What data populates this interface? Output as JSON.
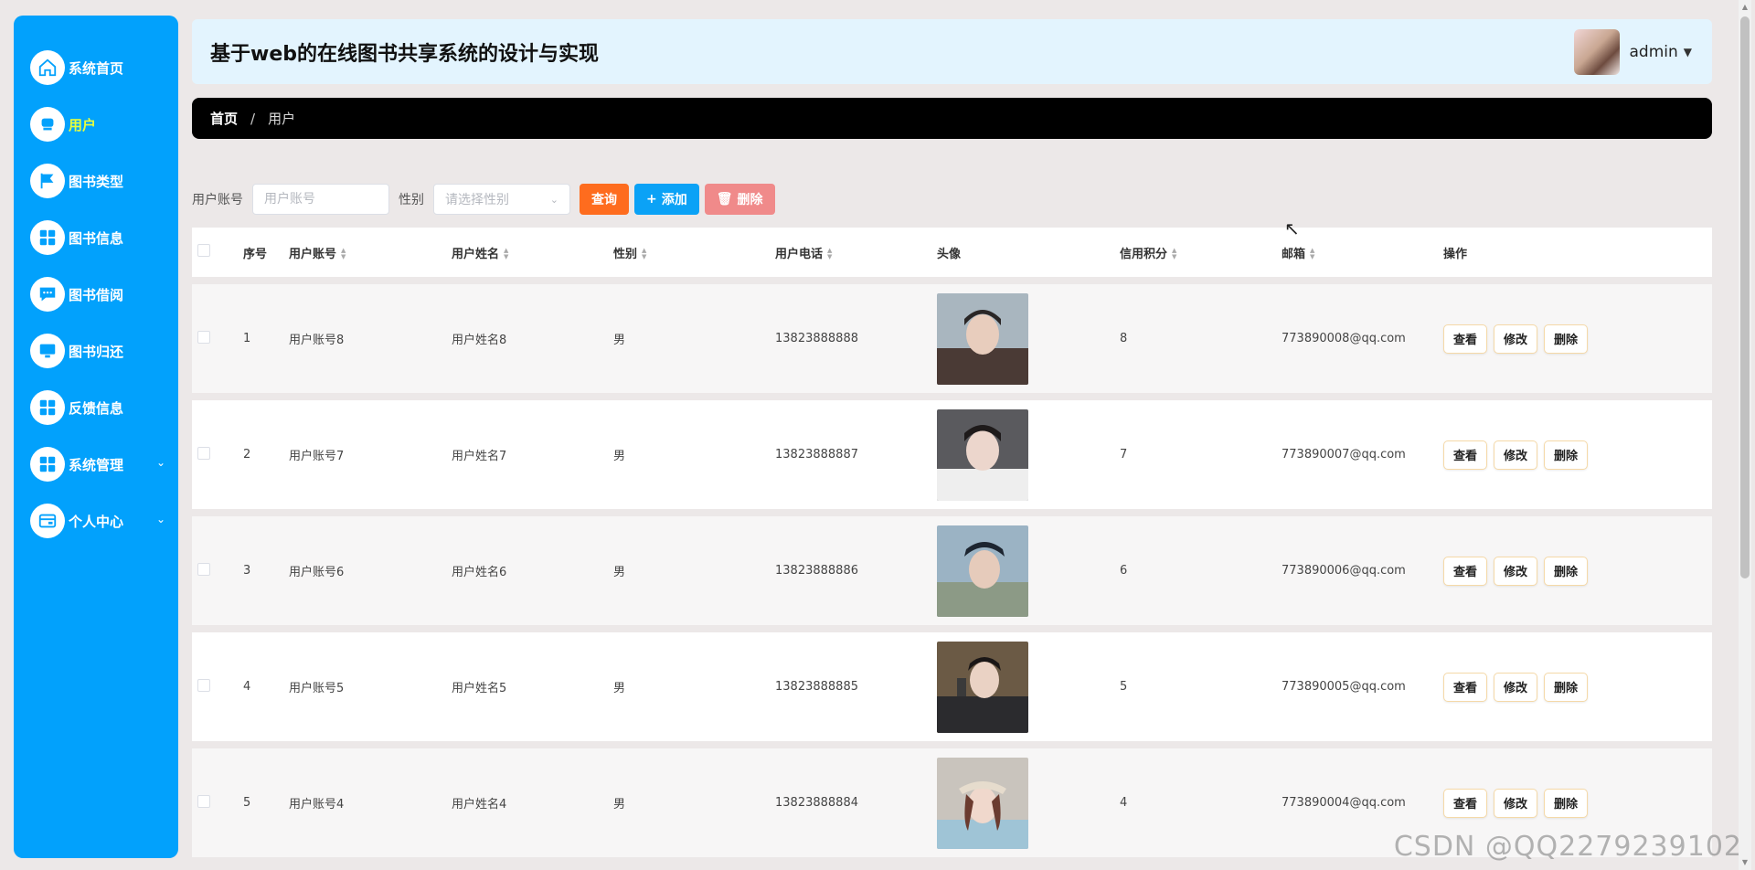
{
  "sidebar": {
    "items": [
      {
        "label": "系统首页",
        "icon": "home-icon"
      },
      {
        "label": "用户",
        "icon": "user-icon",
        "active": true
      },
      {
        "label": "图书类型",
        "icon": "flag-icon"
      },
      {
        "label": "图书信息",
        "icon": "grid-icon"
      },
      {
        "label": "图书借阅",
        "icon": "chat-icon"
      },
      {
        "label": "图书归还",
        "icon": "monitor-icon"
      },
      {
        "label": "反馈信息",
        "icon": "grid-icon"
      },
      {
        "label": "系统管理",
        "icon": "grid-icon",
        "expandable": true
      },
      {
        "label": "个人中心",
        "icon": "card-icon",
        "expandable": true
      }
    ]
  },
  "header": {
    "title": "基于web的在线图书共享系统的设计与实现",
    "user_name": "admin"
  },
  "breadcrumb": {
    "home": "首页",
    "separator": "/",
    "current": "用户"
  },
  "search": {
    "account_label": "用户账号",
    "account_placeholder": "用户账号",
    "gender_label": "性别",
    "gender_placeholder": "请选择性别",
    "query_label": "查询",
    "add_label": "添加",
    "delete_label": "删除"
  },
  "table": {
    "columns": [
      "序号",
      "用户账号",
      "用户姓名",
      "性别",
      "用户电话",
      "头像",
      "信用积分",
      "邮箱",
      "操作"
    ],
    "rows": [
      {
        "idx": "1",
        "account": "用户账号8",
        "name": "用户姓名8",
        "gender": "男",
        "phone": "13823888888",
        "score": "8",
        "email": "773890008@qq.com"
      },
      {
        "idx": "2",
        "account": "用户账号7",
        "name": "用户姓名7",
        "gender": "男",
        "phone": "13823888887",
        "score": "7",
        "email": "773890007@qq.com"
      },
      {
        "idx": "3",
        "account": "用户账号6",
        "name": "用户姓名6",
        "gender": "男",
        "phone": "13823888886",
        "score": "6",
        "email": "773890006@qq.com"
      },
      {
        "idx": "4",
        "account": "用户账号5",
        "name": "用户姓名5",
        "gender": "男",
        "phone": "13823888885",
        "score": "5",
        "email": "773890005@qq.com"
      },
      {
        "idx": "5",
        "account": "用户账号4",
        "name": "用户姓名4",
        "gender": "男",
        "phone": "13823888884",
        "score": "4",
        "email": "773890004@qq.com"
      }
    ],
    "ops": {
      "view": "查看",
      "edit": "修改",
      "delete": "删除"
    }
  },
  "watermark": "CSDN @QQ2279239102",
  "colors": {
    "sidebar_bg": "#02a1fc",
    "active_label": "#e9ff3c",
    "query_btn": "#fe6c1e",
    "add_btn": "#0ba2f6",
    "delete_btn": "#f08a8a"
  }
}
